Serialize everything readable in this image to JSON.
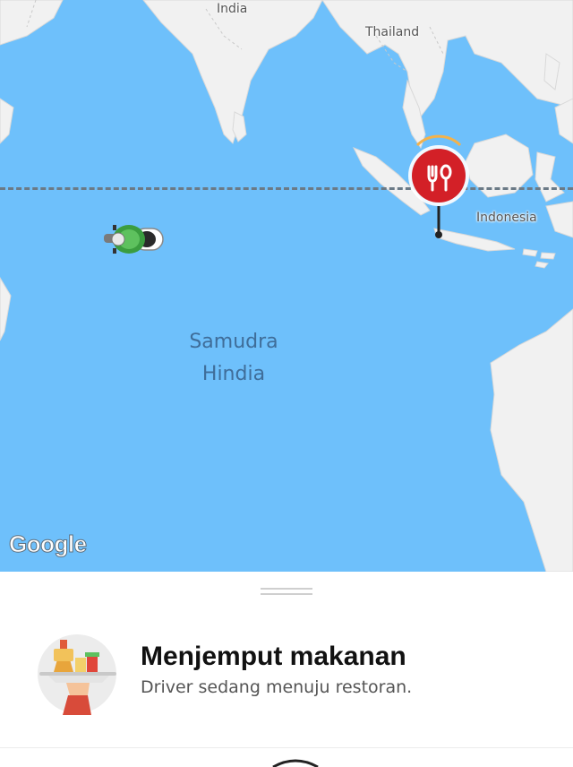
{
  "map": {
    "labels": {
      "india": "India",
      "thailand": "Thailand",
      "indonesia": "Indonesia",
      "ocean_line1": "Samudra",
      "ocean_line2": "Hindia"
    },
    "attribution": "Google",
    "colors": {
      "ocean": "#6ec0fb",
      "land": "#f1f1f1",
      "pin": "#d32027"
    },
    "markers": {
      "restaurant": "restaurant-pin-icon",
      "driver": "driver-motorbike-icon"
    }
  },
  "order_status": {
    "title": "Menjemput makanan",
    "subtitle": "Driver sedang menuju restoran."
  }
}
